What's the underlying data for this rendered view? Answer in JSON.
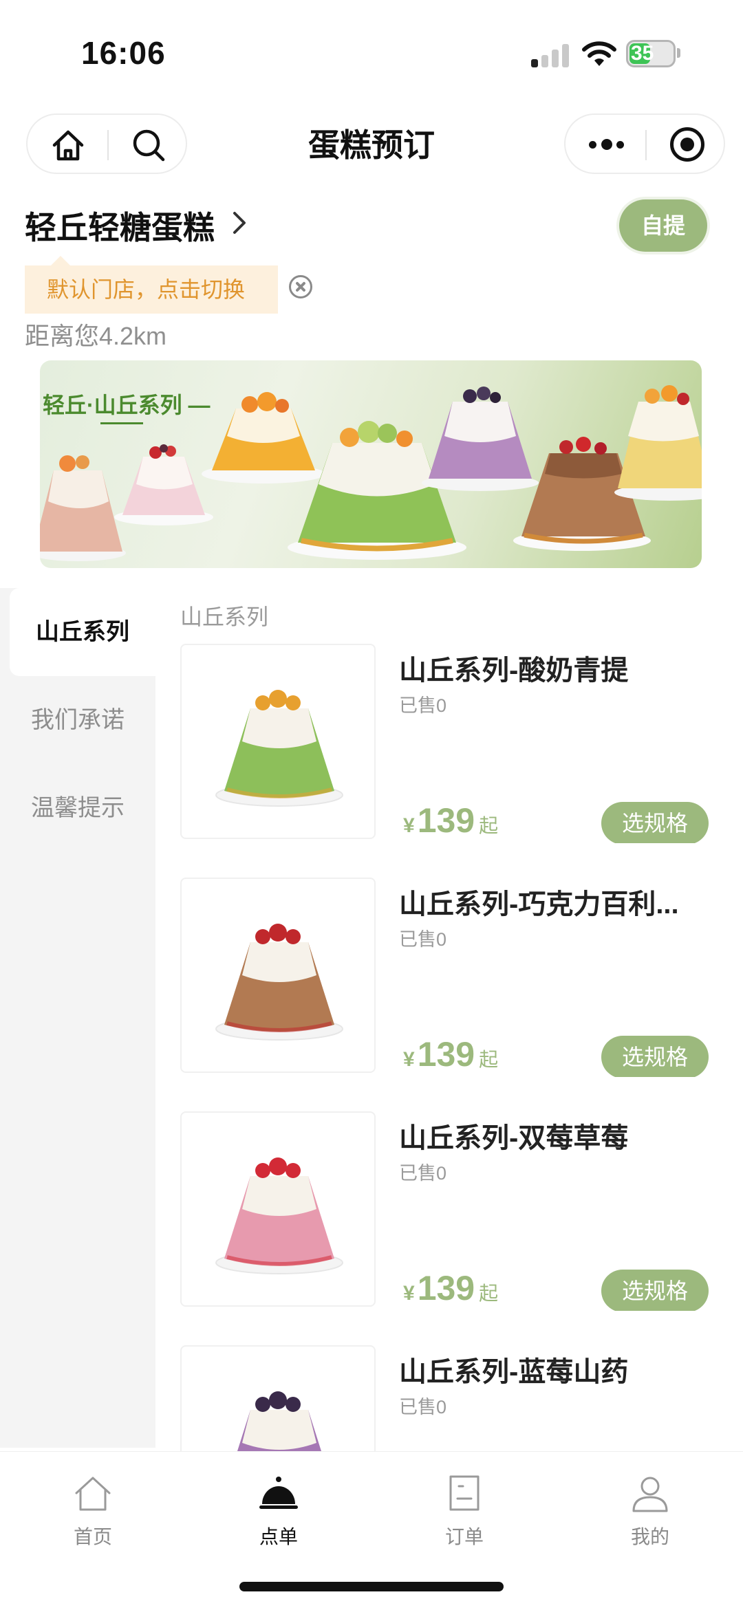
{
  "status_bar": {
    "time": "16:06",
    "battery": "35"
  },
  "nav": {
    "title": "蛋糕预订"
  },
  "store": {
    "name": "轻丘轻糖蛋糕",
    "pickup_label": "自提",
    "default_tip": "默认门店，点击切换",
    "distance": "距离您4.2km"
  },
  "banner": {
    "text": "轻丘·山丘系列 —"
  },
  "sidebar": {
    "items": [
      {
        "label": "山丘系列"
      },
      {
        "label": "我们承诺"
      },
      {
        "label": "温馨提示"
      }
    ]
  },
  "section": {
    "title": "山丘系列"
  },
  "products": [
    {
      "name": "山丘系列-酸奶青提",
      "sold": "已售0",
      "currency": "¥",
      "price": "139",
      "suffix": "起",
      "button": "选规格",
      "accent": "#8dbf5a",
      "topping": "#e7a02f"
    },
    {
      "name": "山丘系列-巧克力百利...",
      "sold": "已售0",
      "currency": "¥",
      "price": "139",
      "suffix": "起",
      "button": "选规格",
      "accent": "#b27a52",
      "topping": "#c0282c"
    },
    {
      "name": "山丘系列-双莓草莓",
      "sold": "已售0",
      "currency": "¥",
      "price": "139",
      "suffix": "起",
      "button": "选规格",
      "accent": "#e79aae",
      "topping": "#d22a36"
    },
    {
      "name": "山丘系列-蓝莓山药",
      "sold": "已售0",
      "currency": "¥",
      "price": "",
      "suffix": "",
      "button": "",
      "accent": "#a577b4",
      "topping": "#3a2a4a"
    }
  ],
  "tabbar": {
    "items": [
      {
        "label": "首页",
        "icon": "home-icon"
      },
      {
        "label": "点单",
        "icon": "cloche-icon"
      },
      {
        "label": "订单",
        "icon": "order-icon"
      },
      {
        "label": "我的",
        "icon": "user-icon"
      }
    ]
  },
  "colors": {
    "accent_green": "#9cb97d",
    "tip_orange": "#e0952e",
    "tip_bg": "#fdf0dd"
  }
}
